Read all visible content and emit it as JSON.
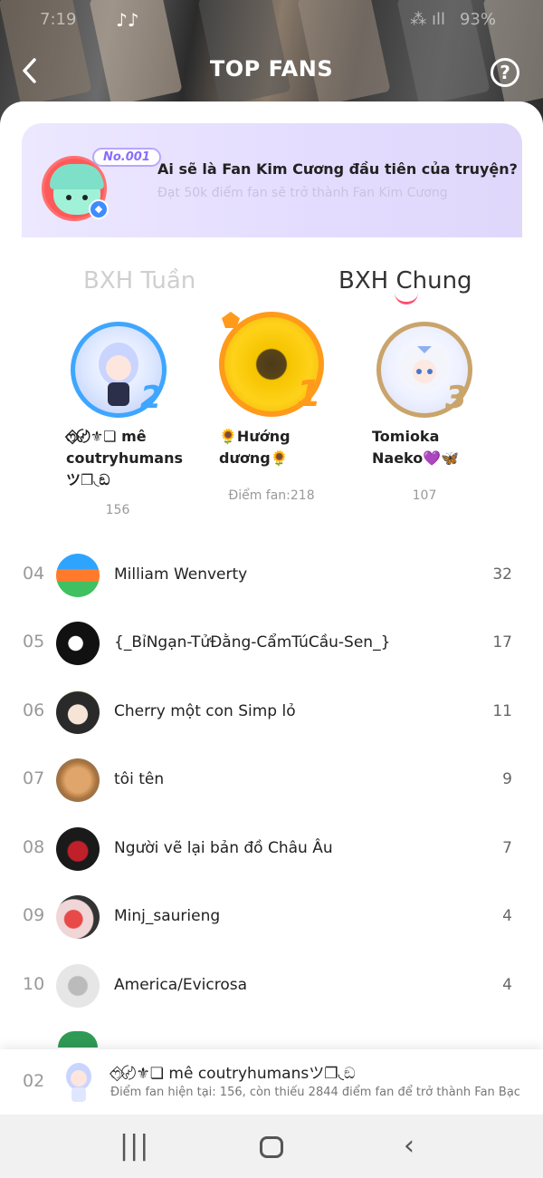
{
  "status_bar": {
    "time": "7:19",
    "app_icons": "♪♪",
    "signal": "⁂ ıll",
    "battery": "93%"
  },
  "header": {
    "title": "TOP FANS",
    "back_icon": "chevron-left-icon",
    "help_glyph": "?"
  },
  "banner": {
    "badge": "No.001",
    "question": "Ai sẽ là Fan Kim Cương đầu tiên của truyện?",
    "subtitle": "Đạt 50k điểm fan sẽ trở thành Fan Kim Cương"
  },
  "tabs": {
    "week": "BXH Tuần",
    "all": "BXH Chung"
  },
  "podium": [
    {
      "rank": "2",
      "name_line1": "ෆ⃟〄⚜❏ mê",
      "name_line2": "coutryhumans",
      "name_line3": "ツ❐◟ඞ",
      "score": "156",
      "color": "#3ea6ff"
    },
    {
      "rank": "1",
      "name_line1": "🌻Hướng",
      "name_line2": "dương🌻",
      "name_line3": "",
      "score": "Điểm fan:218",
      "color": "#ff9a1a"
    },
    {
      "rank": "3",
      "name_line1": "Tomioka",
      "name_line2": "Naeko💜🦋",
      "name_line3": "",
      "score": "107",
      "color": "#c9a46b"
    }
  ],
  "list": [
    {
      "rank": "04",
      "name": "Milliam Wenverty",
      "score": "32"
    },
    {
      "rank": "05",
      "name": "{_BỉNgạn-TửĐằng-CẩmTúCầu-Sen_}",
      "score": "17"
    },
    {
      "rank": "06",
      "name": "Cherry một con Simp lỏ",
      "score": "11"
    },
    {
      "rank": "07",
      "name": "tôi tên",
      "score": "9"
    },
    {
      "rank": "08",
      "name": "Người vẽ lại bản đồ Châu Âu",
      "score": "7"
    },
    {
      "rank": "09",
      "name": "Minj_saurieng",
      "score": "4"
    },
    {
      "rank": "10",
      "name": "America/Evicrosa",
      "score": "4"
    }
  ],
  "me": {
    "rank": "02",
    "name": "ෆ⃟〄⚜❏ mê coutryhumansツ❐◟ඞ",
    "status": "Điểm fan hiện tại: 156, còn thiếu 2844 điểm fan để trở thành Fan Bạc"
  },
  "nav": {
    "recent": "|||",
    "back": "‹"
  }
}
